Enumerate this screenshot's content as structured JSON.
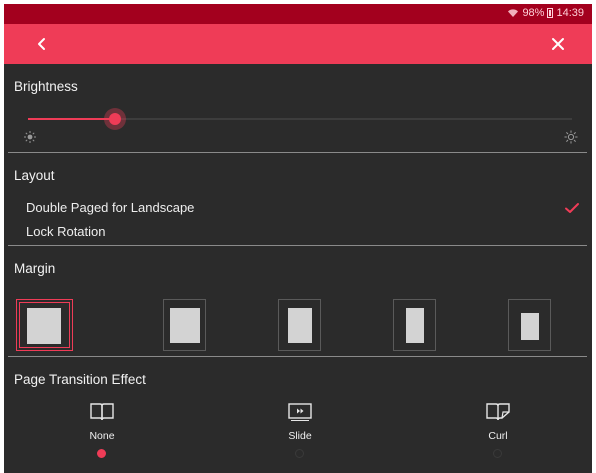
{
  "status_bar": {
    "battery": "98%",
    "time": "14:39"
  },
  "sections": {
    "brightness": {
      "title": "Brightness",
      "level_percent": 16
    },
    "layout": {
      "title": "Layout",
      "options": [
        {
          "label": "Double Paged for Landscape",
          "checked": true
        },
        {
          "label": "Lock Rotation",
          "checked": false
        }
      ]
    },
    "margin": {
      "title": "Margin",
      "selected_index": 0,
      "option_count": 5
    },
    "transition": {
      "title": "Page Transition Effect",
      "effects": [
        {
          "label": "None",
          "selected": true,
          "icon": "open-book-icon"
        },
        {
          "label": "Slide",
          "selected": false,
          "icon": "slide-page-icon"
        },
        {
          "label": "Curl",
          "selected": false,
          "icon": "curl-page-icon"
        }
      ]
    }
  },
  "colors": {
    "accent": "#ef3c57",
    "status_bar": "#a3001e",
    "background": "#2b2b2b"
  }
}
